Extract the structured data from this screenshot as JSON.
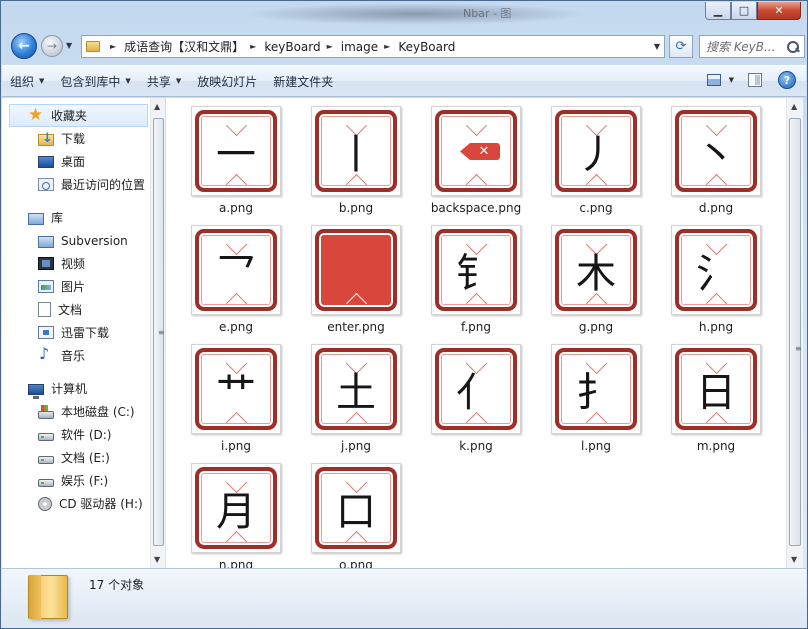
{
  "window": {
    "title": "Nbar - 图",
    "controls": [
      "minimize",
      "maximize",
      "close"
    ]
  },
  "nav": {
    "back_icon": "back-arrow-icon",
    "forward_icon": "forward-arrow-icon"
  },
  "address": {
    "crumbs": [
      "成语查询【汉和文鼎】",
      "keyBoard",
      "image",
      "KeyBoard"
    ]
  },
  "search": {
    "placeholder": "搜索 KeyB..."
  },
  "toolbar": {
    "organize": "组织",
    "include_in_library": "包含到库中",
    "share": "共享",
    "slideshow": "放映幻灯片",
    "new_folder": "新建文件夹"
  },
  "sidebar": {
    "favorites": {
      "label": "收藏夹",
      "items": [
        "下载",
        "桌面",
        "最近访问的位置"
      ]
    },
    "libraries": {
      "label": "库",
      "items": [
        "Subversion",
        "视频",
        "图片",
        "文档",
        "迅雷下载",
        "音乐"
      ]
    },
    "computer": {
      "label": "计算机",
      "items": [
        "本地磁盘 (C:)",
        "软件 (D:)",
        "文档 (E:)",
        "娱乐 (F:)",
        "CD 驱动器 (H:)"
      ]
    }
  },
  "files": [
    {
      "name": "a.png",
      "glyph": "一",
      "style": "char"
    },
    {
      "name": "b.png",
      "glyph": "丨",
      "style": "char"
    },
    {
      "name": "backspace.png",
      "glyph": "✕",
      "style": "backspace"
    },
    {
      "name": "c.png",
      "glyph": "丿",
      "style": "char"
    },
    {
      "name": "d.png",
      "glyph": "丶",
      "style": "char"
    },
    {
      "name": "e.png",
      "glyph": "乛",
      "style": "char"
    },
    {
      "name": "enter.png",
      "glyph": "",
      "style": "filled"
    },
    {
      "name": "f.png",
      "glyph": "钅",
      "style": "char"
    },
    {
      "name": "g.png",
      "glyph": "木",
      "style": "char"
    },
    {
      "name": "h.png",
      "glyph": "氵",
      "style": "char"
    },
    {
      "name": "i.png",
      "glyph": "艹",
      "style": "char"
    },
    {
      "name": "j.png",
      "glyph": "土",
      "style": "char"
    },
    {
      "name": "k.png",
      "glyph": "亻",
      "style": "char"
    },
    {
      "name": "l.png",
      "glyph": "扌",
      "style": "char"
    },
    {
      "name": "m.png",
      "glyph": "日",
      "style": "char"
    },
    {
      "name": "n.png",
      "glyph": "月",
      "style": "char"
    },
    {
      "name": "o.png",
      "glyph": "口",
      "style": "char"
    }
  ],
  "status": {
    "count": "17 个对象"
  },
  "colors": {
    "key_border": "#9d2f28",
    "key_accent": "#d9463b",
    "window_frame": "#c4d9ef"
  }
}
